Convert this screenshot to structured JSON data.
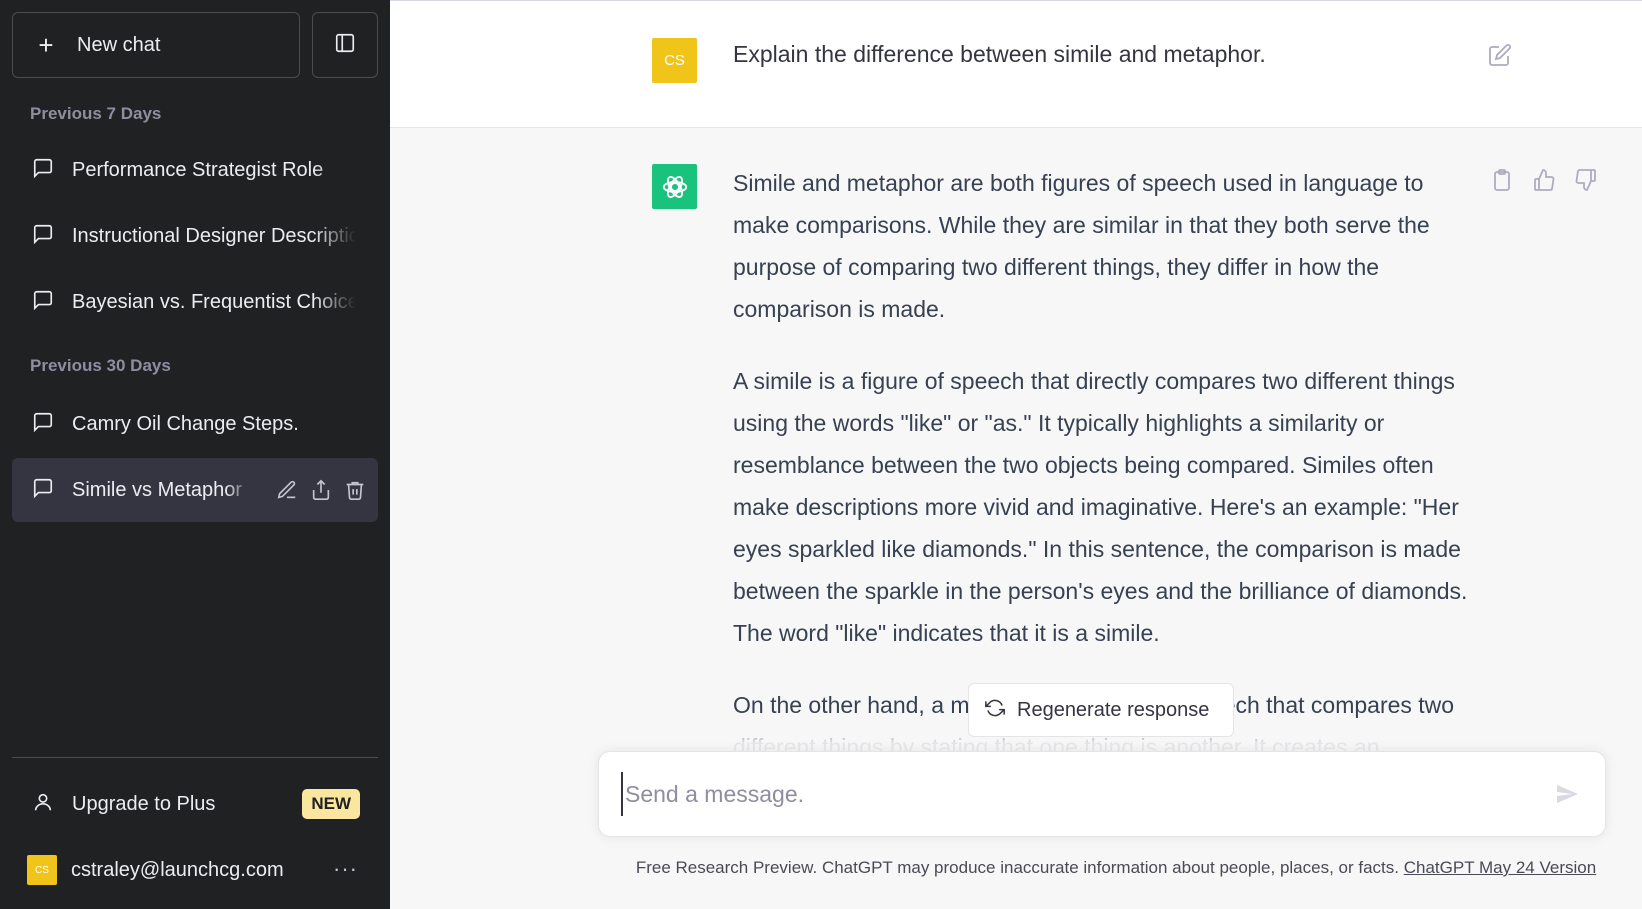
{
  "sidebar": {
    "new_chat_label": "New chat",
    "sections": [
      {
        "label": "Previous 7 Days",
        "items": [
          {
            "title": "Performance Strategist Role"
          },
          {
            "title": "Instructional Designer Description"
          },
          {
            "title": "Bayesian vs. Frequentist Choice"
          }
        ]
      },
      {
        "label": "Previous 30 Days",
        "items": [
          {
            "title": "Camry Oil Change Steps."
          },
          {
            "title": "Simile vs Metaphor"
          }
        ]
      }
    ],
    "upgrade_label": "Upgrade to Plus",
    "upgrade_badge": "NEW",
    "account": {
      "initials": "CS",
      "email": "cstraley@launchcg.com",
      "more_label": "···"
    }
  },
  "conversation": {
    "user": {
      "initials": "CS",
      "message": "Explain the difference between simile and metaphor."
    },
    "assistant": {
      "paragraphs": [
        "Simile and metaphor are both figures of speech used in language to make comparisons. While they are similar in that they both serve the purpose of comparing two different things, they differ in how the comparison is made.",
        "A simile is a figure of speech that directly compares two different things using the words \"like\" or \"as.\" It typically highlights a similarity or resemblance between the two objects being compared. Similes often make descriptions more vivid and imaginative. Here's an example: \"Her eyes sparkled like diamonds.\" In this sentence, the comparison is made between the sparkle in the person's eyes and the brilliance of diamonds. The word \"like\" indicates that it is a simile.",
        "On the other hand, a metaphor is a figure of speech that compares two different things by stating that one thing is another. It creates an"
      ]
    }
  },
  "composer": {
    "regenerate_label": "Regenerate response",
    "placeholder": "Send a message.",
    "value": ""
  },
  "footer": {
    "text": "Free Research Preview. ChatGPT may produce inaccurate information about people, places, or facts. ",
    "link_label": "ChatGPT May 24 Version"
  },
  "colors": {
    "sidebar_bg": "#202123",
    "active_item_bg": "#343541",
    "user_avatar": "#f0c419",
    "assistant_avatar": "#19c37d",
    "badge_bg": "#fae69e"
  },
  "icons": {
    "new_chat": "plus-icon",
    "toggle": "sidebar-toggle-icon",
    "chat": "chat-bubble-icon",
    "rename": "pencil-icon",
    "share": "share-icon",
    "delete": "trash-icon",
    "upgrade": "user-icon",
    "edit": "edit-icon",
    "copy": "clipboard-icon",
    "thumbs_up": "thumbs-up-icon",
    "thumbs_down": "thumbs-down-icon",
    "regenerate": "refresh-icon",
    "send": "send-icon"
  }
}
